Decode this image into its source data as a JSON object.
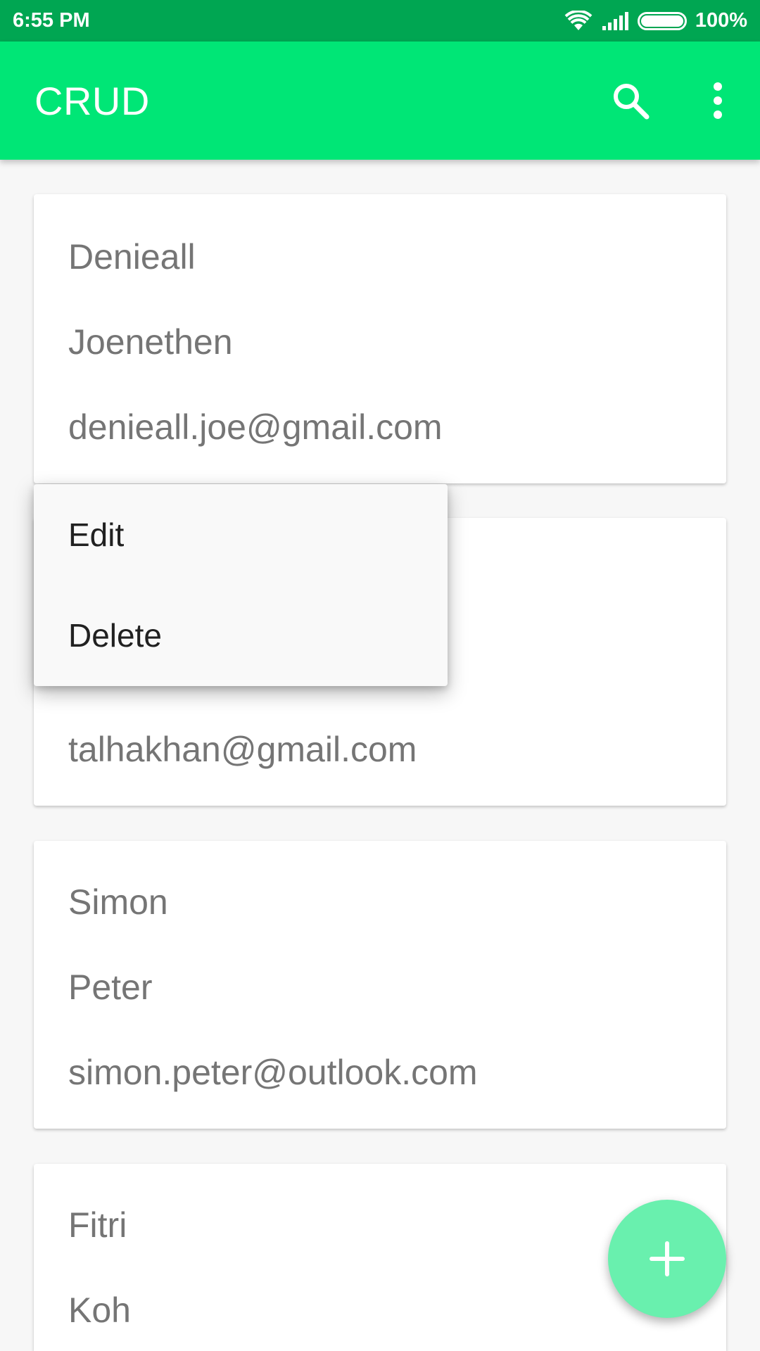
{
  "status_bar": {
    "time": "6:55 PM",
    "battery": "100%",
    "battery_level": 1.0,
    "icons": [
      "wifi-icon",
      "signal-icon",
      "battery-icon"
    ]
  },
  "app_bar": {
    "title": "CRUD",
    "actions": [
      "search-icon",
      "more-vert-icon"
    ],
    "color": "#00e676",
    "status_color": "#00a652"
  },
  "contacts": [
    {
      "first": "Denieall",
      "last": "Joenethen",
      "email": "denieall.joe@gmail.com"
    },
    {
      "first": "",
      "last": "",
      "email": "talhakhan@gmail.com"
    },
    {
      "first": "Simon",
      "last": "Peter",
      "email": "simon.peter@outlook.com"
    },
    {
      "first": "Fitri",
      "last": "Koh",
      "email": ""
    }
  ],
  "context_menu": {
    "items": [
      "Edit",
      "Delete"
    ]
  },
  "fab": {
    "icon": "add-icon",
    "color": "#69f0ae"
  }
}
